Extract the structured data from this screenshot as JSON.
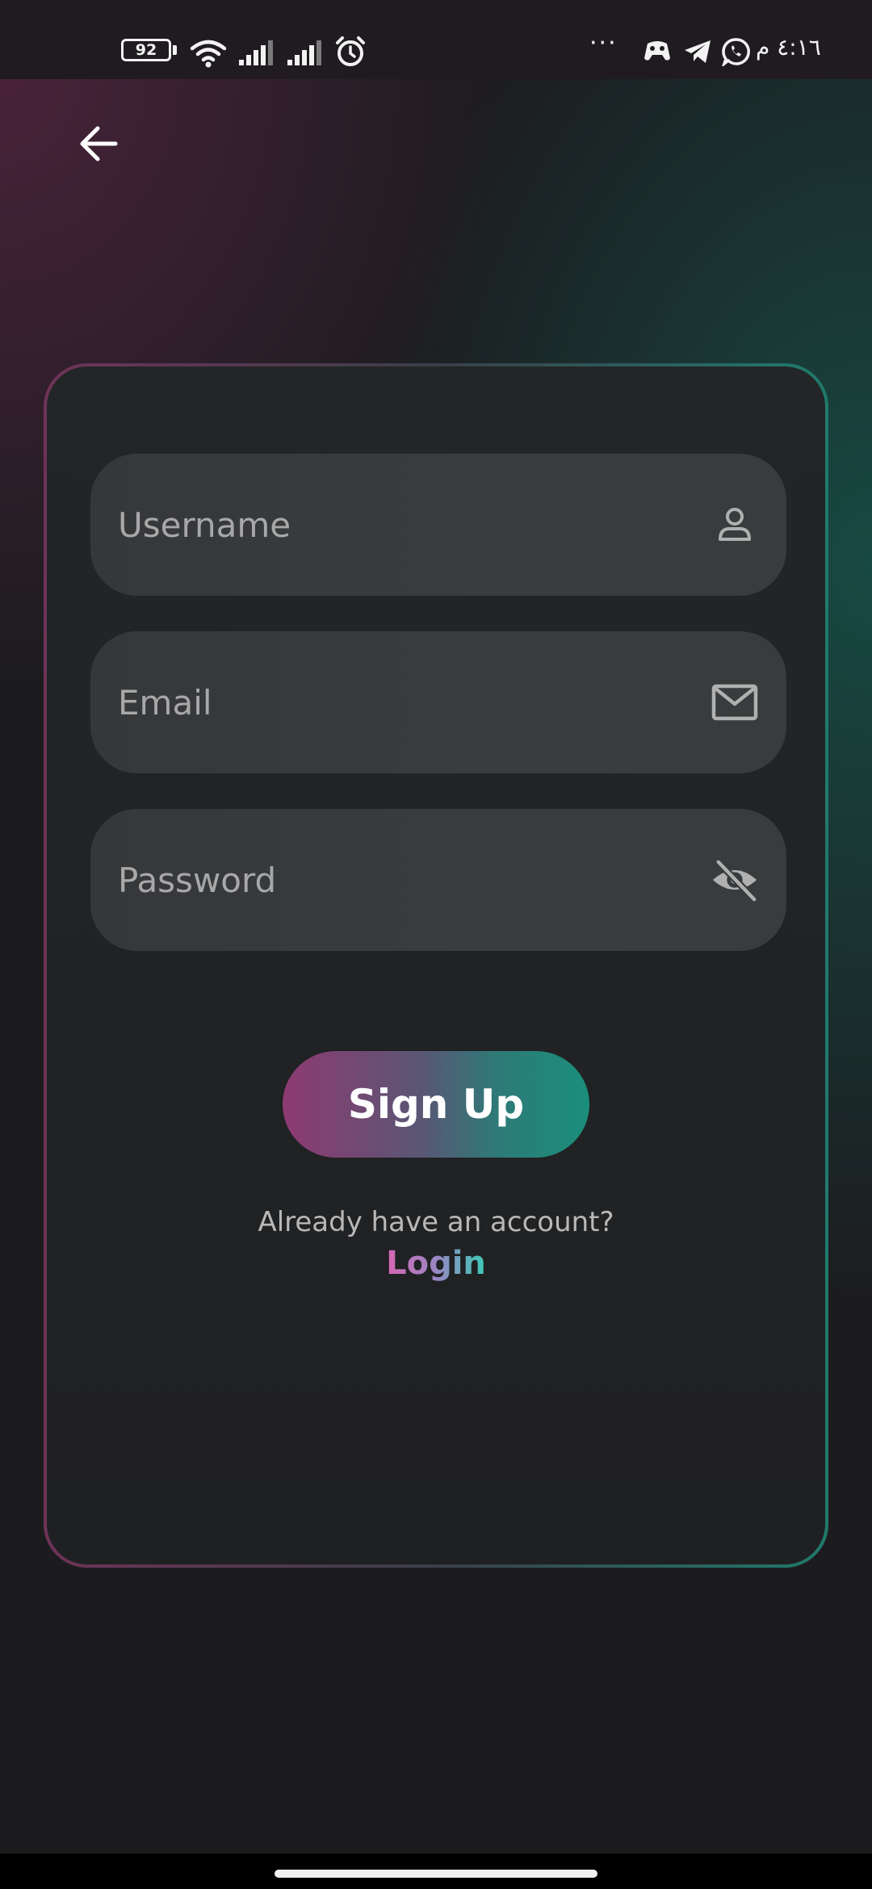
{
  "status_bar": {
    "battery": "92",
    "time": "٤:١٦ م",
    "more": "···",
    "icons": [
      "battery-icon",
      "wifi-icon",
      "signal-icon",
      "signal-icon",
      "alarm-icon",
      "game-controller-icon",
      "telegram-icon",
      "whatsapp-icon"
    ]
  },
  "header": {
    "back_icon": "arrow-left-icon"
  },
  "form": {
    "username": {
      "placeholder": "Username",
      "value": "",
      "icon": "person-icon"
    },
    "email": {
      "placeholder": "Email",
      "value": "",
      "icon": "mail-icon"
    },
    "password": {
      "placeholder": "Password",
      "value": "",
      "icon": "eye-off-icon"
    },
    "signup_label": "Sign Up",
    "account_prompt": "Already have an account?",
    "login_label": "Login"
  },
  "colors": {
    "accent_pink": "#8e3a72",
    "accent_teal": "#1a8f7a",
    "background": "#1c1c1f"
  }
}
